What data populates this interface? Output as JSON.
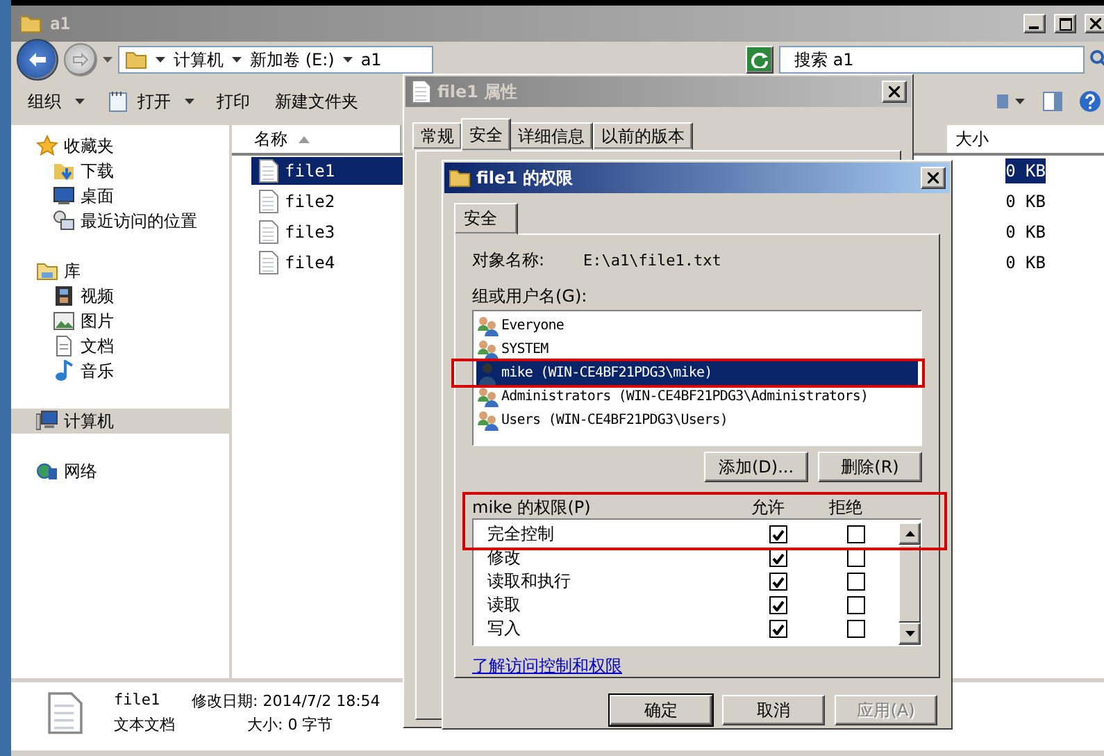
{
  "explorer": {
    "title": "a1",
    "breadcrumbs": [
      "计算机",
      "新加卷 (E:)",
      "a1"
    ],
    "search": {
      "placeholder": "搜索 a1"
    },
    "toolbar": [
      {
        "label": "组织",
        "dropdown": true
      },
      {
        "label": "打开",
        "dropdown": true
      },
      {
        "label": "打印",
        "dropdown": false
      },
      {
        "label": "新建文件夹",
        "dropdown": false
      }
    ],
    "sidebar": [
      {
        "label": "收藏夹",
        "selected": false,
        "children": [
          {
            "label": "下载",
            "selected": false
          },
          {
            "label": "桌面",
            "selected": false
          },
          {
            "label": "最近访问的位置",
            "selected": false
          }
        ]
      },
      {
        "label": "库",
        "selected": false,
        "children": [
          {
            "label": "视频",
            "selected": false
          },
          {
            "label": "图片",
            "selected": false
          },
          {
            "label": "文档",
            "selected": false
          },
          {
            "label": "音乐",
            "selected": false
          }
        ]
      },
      {
        "label": "计算机",
        "selected": true
      },
      {
        "label": "网络",
        "selected": false
      }
    ],
    "columns": [
      "名称",
      "大小"
    ],
    "files": [
      {
        "name": "file1",
        "size": "0 KB",
        "selected": true
      },
      {
        "name": "file2",
        "size": "0 KB",
        "selected": false
      },
      {
        "name": "file3",
        "size": "0 KB",
        "selected": false
      },
      {
        "name": "file4",
        "size": "0 KB",
        "selected": false
      }
    ],
    "details": {
      "name": "file1",
      "type": "文本文档",
      "modified": "修改日期: 2014/7/2 18:54",
      "size": "大小: 0 字节"
    }
  },
  "properties_dialog": {
    "title": "file1 属性",
    "tabs": [
      {
        "label": "常规",
        "selected": false
      },
      {
        "label": "安全",
        "selected": true
      },
      {
        "label": "详细信息",
        "selected": false
      },
      {
        "label": "以前的版本",
        "selected": false
      }
    ]
  },
  "permissions_dialog": {
    "title": "file1 的权限",
    "tabs": [
      {
        "label": "安全",
        "selected": true
      }
    ],
    "object_label": "对象名称:",
    "object_name": "E:\\a1\\file1.txt",
    "group_label": "组或用户名(G):",
    "principals": [
      {
        "name": "Everyone",
        "kind": "group",
        "selected": false,
        "highlighted": false
      },
      {
        "name": "SYSTEM",
        "kind": "group",
        "selected": false,
        "highlighted": false
      },
      {
        "name": "mike (WIN-CE4BF21PDG3\\mike)",
        "kind": "user",
        "selected": true,
        "highlighted": true
      },
      {
        "name": "Administrators (WIN-CE4BF21PDG3\\Administrators)",
        "kind": "group",
        "selected": false,
        "highlighted": false
      },
      {
        "name": "Users (WIN-CE4BF21PDG3\\Users)",
        "kind": "group",
        "selected": false,
        "highlighted": false
      }
    ],
    "add_button": "添加(D)...",
    "remove_button": "删除(R)",
    "permissions_label": "mike 的权限(P)",
    "allow_header": "允许",
    "deny_header": "拒绝",
    "header_highlighted": true,
    "permissions": [
      {
        "name": "完全控制",
        "allow": true,
        "deny": false
      },
      {
        "name": "修改",
        "allow": true,
        "deny": false
      },
      {
        "name": "读取和执行",
        "allow": true,
        "deny": false
      },
      {
        "name": "读取",
        "allow": true,
        "deny": false
      },
      {
        "name": "写入",
        "allow": true,
        "deny": false
      }
    ],
    "link": "了解访问控制和权限",
    "buttons": [
      {
        "label": "确定",
        "kind": "default",
        "disabled": false
      },
      {
        "label": "取消",
        "kind": "normal",
        "disabled": false
      },
      {
        "label": "应用(A)",
        "kind": "normal",
        "disabled": true
      }
    ]
  }
}
